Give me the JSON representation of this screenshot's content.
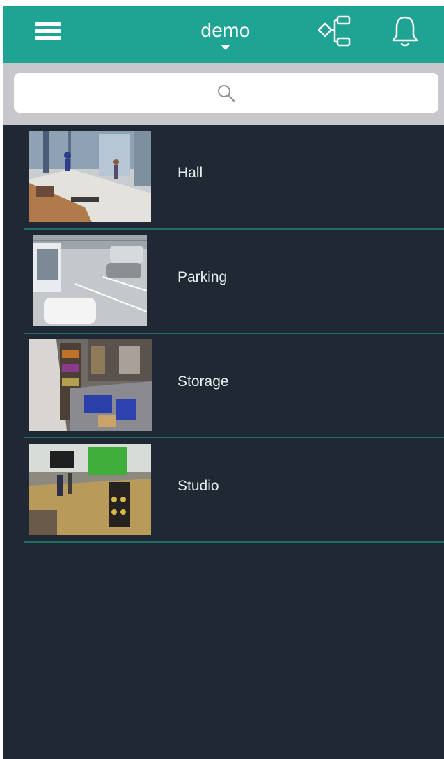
{
  "header": {
    "title": "demo",
    "menu_icon": "hamburger-menu-icon",
    "tree_icon": "hierarchy-tree-icon",
    "bell_icon": "bell-icon",
    "caret_icon": "caret-down-icon",
    "accent_color": "#1fa393"
  },
  "search": {
    "value": "",
    "placeholder": "",
    "icon": "search-icon"
  },
  "cameras": [
    {
      "label": "Hall"
    },
    {
      "label": "Parking"
    },
    {
      "label": "Storage"
    },
    {
      "label": "Studio"
    }
  ],
  "colors": {
    "background": "#1f2833",
    "divider": "#1d6f67",
    "search_bar": "#c7c7cc"
  }
}
